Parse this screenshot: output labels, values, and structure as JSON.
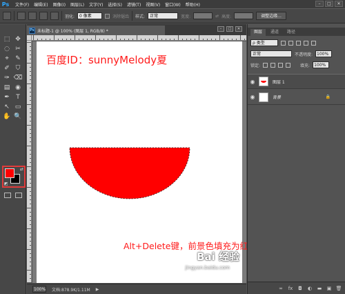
{
  "menubar": {
    "logo": "Ps",
    "items": [
      "文件(F)",
      "编辑(E)",
      "图像(I)",
      "图层(L)",
      "文字(Y)",
      "选择(S)",
      "滤镜(T)",
      "视图(V)",
      "窗口(W)",
      "帮助(H)"
    ],
    "min": "–",
    "max": "□",
    "close": "✕"
  },
  "options": {
    "feather_label": "羽化:",
    "feather_value": "0 像素",
    "antialias_label": "消除锯齿",
    "style_label": "样式:",
    "style_value": "正常",
    "width_label": "宽度:",
    "height_label": "高度:",
    "refine_button": "调整边缘..."
  },
  "document": {
    "tab_title": "未标题-1 @ 100% (图层 1, RGB/8) *",
    "ps_mini": "Ps",
    "canvas_title": "百度ID：sunnyMelody夏",
    "caption": "Alt+Delete键，前景色填充为红色",
    "watermark": "Bai 经验",
    "watermark_du": "du",
    "watermark_url": "jingyan.baidu.com",
    "fill_color": "#ff0000"
  },
  "status": {
    "zoom": "100%",
    "doc_info": "文档:878.9K/1.11M",
    "arrow": "▶"
  },
  "panel": {
    "tabs": [
      "图层",
      "通道",
      "路径"
    ],
    "filter_kind": "ρ 类型",
    "blend_mode": "正常",
    "opacity_label": "不透明度:",
    "opacity_value": "100%",
    "lock_label": "锁定:",
    "fill_label": "填充:",
    "fill_value": "100%",
    "layers": [
      {
        "name": "图层 1",
        "selected": true
      },
      {
        "name": "背景",
        "selected": false,
        "locked": true
      }
    ],
    "bottom_icons": [
      "link-icon",
      "fx-icon",
      "mask-icon",
      "adjust-icon",
      "folder-icon",
      "new-layer-icon",
      "trash-icon"
    ]
  },
  "toolbar": {
    "tools": [
      "⬚",
      "✥",
      "◌",
      "✂",
      "⌖",
      "✎",
      "✐",
      "⛉",
      "✑",
      "⌫",
      "▤",
      "◉",
      "✒",
      "T",
      "↖",
      "▭",
      "✋",
      "🔍"
    ],
    "swap": "⇄",
    "default": "◩"
  },
  "colors": {
    "foreground": "#ff0000",
    "background": "#000000",
    "highlight": "#e23b3b"
  }
}
